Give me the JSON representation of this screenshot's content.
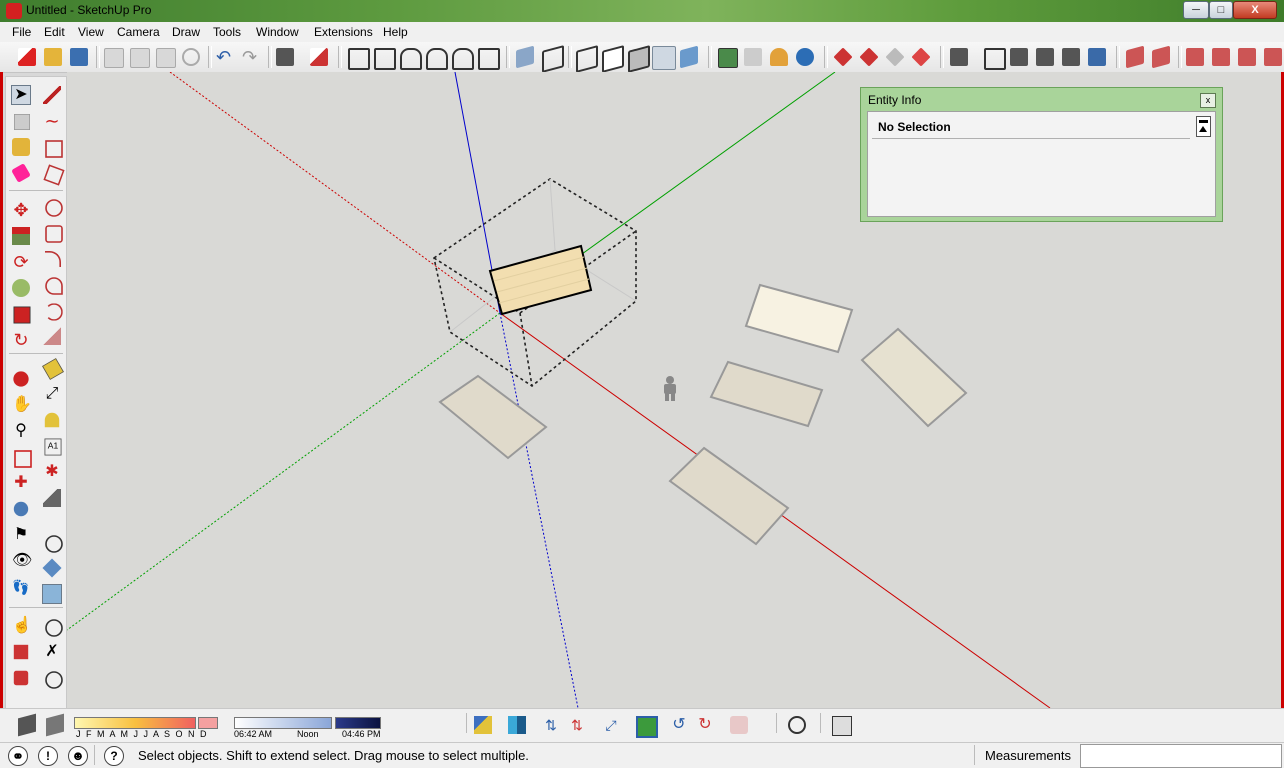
{
  "window": {
    "title": "Untitled - SketchUp Pro",
    "minimize": "─",
    "maximize": "□",
    "close": "X"
  },
  "menu": [
    "File",
    "Edit",
    "View",
    "Camera",
    "Draw",
    "Tools",
    "Window",
    "Extensions",
    "Help"
  ],
  "entity_info": {
    "title": "Entity Info",
    "close": "x",
    "heading": "No Selection"
  },
  "timeline": {
    "months": "J F M A M J J A S O N D",
    "time_start": "06:42 AM",
    "time_mid": "Noon",
    "time_end": "04:46 PM"
  },
  "status": {
    "message": "Select objects. Shift to extend select. Drag mouse to select multiple.",
    "measurements_label": "Measurements",
    "measurements_value": "",
    "help_icon": "?",
    "info_icon": "!"
  },
  "colors": {
    "red_axis": "#cc0000",
    "green_axis": "#00aa00",
    "blue_axis": "#0000cc",
    "entity_panel": "#a9d49a",
    "selected_face": "#f2deb0"
  },
  "icons": [
    "select-icon",
    "pencil-icon",
    "eraser-icon",
    "paint-bucket-icon",
    "move-icon",
    "push-pull-icon",
    "rotate-icon",
    "follow-me-icon",
    "scale-icon",
    "offset-icon",
    "orbit-icon",
    "pan-icon",
    "zoom-icon",
    "zoom-window-icon",
    "zoom-extents-icon",
    "walk-icon",
    "look-around-icon",
    "tape-measure-icon",
    "protractor-icon",
    "text-icon",
    "axes-icon",
    "dimension-icon",
    "section-plane-icon"
  ]
}
